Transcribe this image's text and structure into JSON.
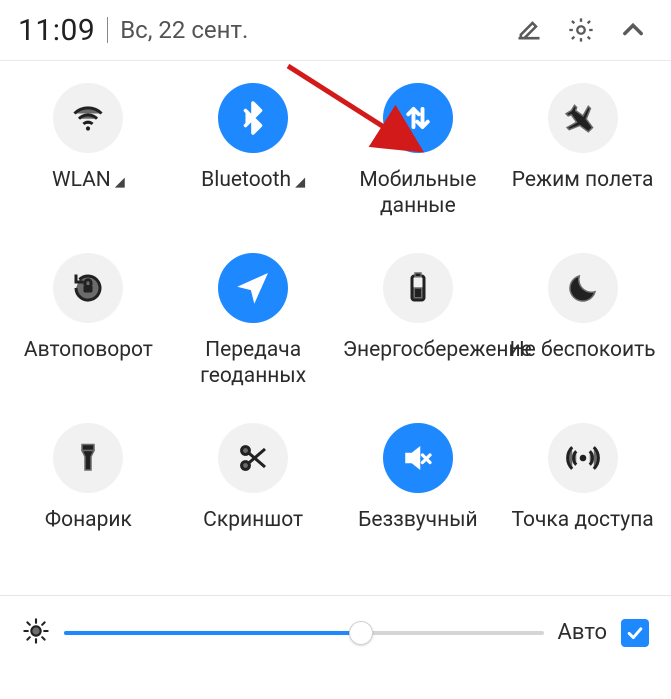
{
  "status": {
    "time": "11:09",
    "date": "Вс, 22 сент."
  },
  "tiles": [
    {
      "key": "wlan",
      "label": "WLAN",
      "active": false,
      "expandable": true
    },
    {
      "key": "bluetooth",
      "label": "Bluetooth",
      "active": true,
      "expandable": true
    },
    {
      "key": "mobile-data",
      "label": "Мобильные данные",
      "active": true,
      "expandable": false
    },
    {
      "key": "airplane",
      "label": "Режим полета",
      "active": false,
      "expandable": false
    },
    {
      "key": "auto-rotate",
      "label": "Автоповорот",
      "active": false,
      "expandable": false
    },
    {
      "key": "location",
      "label": "Передача геоданных",
      "active": true,
      "expandable": false
    },
    {
      "key": "power-save",
      "label": "Энергосбережение",
      "active": false,
      "expandable": false
    },
    {
      "key": "dnd",
      "label": "Не беспокоить",
      "active": false,
      "expandable": false
    },
    {
      "key": "flashlight",
      "label": "Фонарик",
      "active": false,
      "expandable": false
    },
    {
      "key": "screenshot",
      "label": "Скриншот",
      "active": false,
      "expandable": false
    },
    {
      "key": "mute",
      "label": "Беззвучный",
      "active": true,
      "expandable": false
    },
    {
      "key": "hotspot",
      "label": "Точка доступа",
      "active": false,
      "expandable": false
    }
  ],
  "brightness": {
    "value_pct": 62,
    "auto_label": "Авто",
    "auto_on": true
  },
  "colors": {
    "accent": "#1e88ff",
    "annotation": "#d21a1a"
  }
}
